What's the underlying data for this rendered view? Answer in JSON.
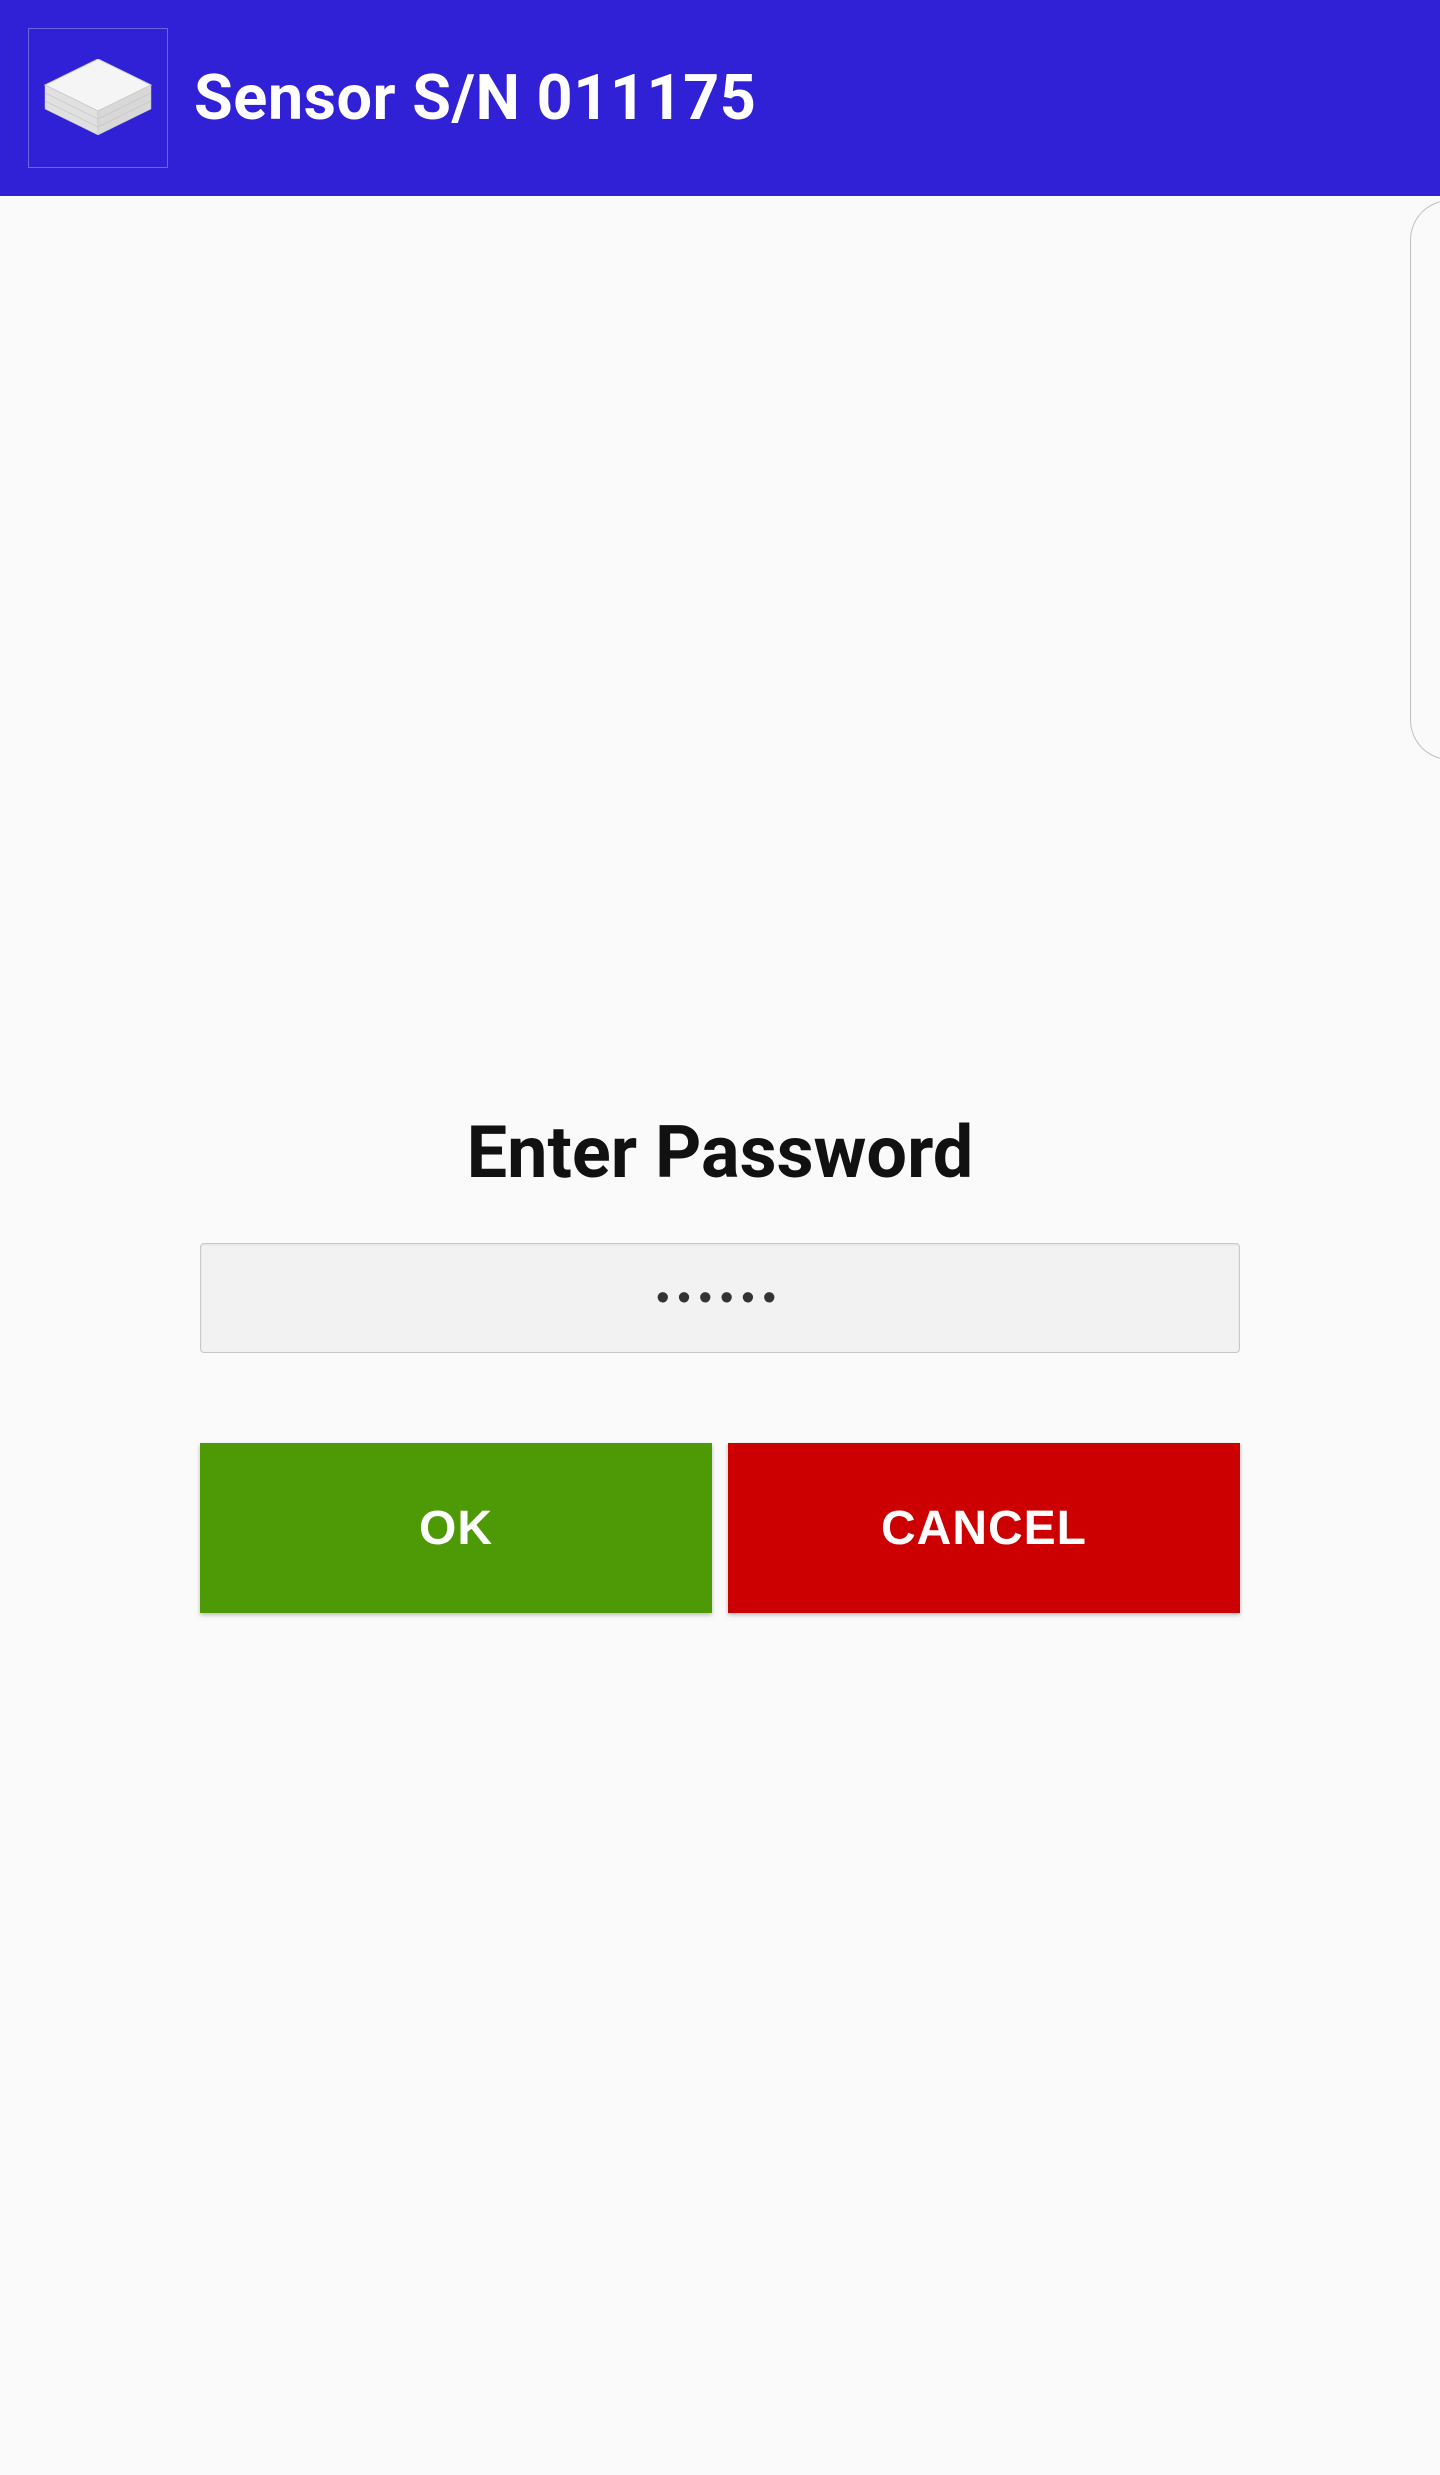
{
  "header": {
    "title": "Sensor S/N 011175"
  },
  "password_dialog": {
    "prompt": "Enter Password",
    "value": "••••••",
    "ok_label": "OK",
    "cancel_label": "CANCEL"
  },
  "colors": {
    "header_bg": "#3021d6",
    "ok_bg": "#4e9a06",
    "cancel_bg": "#cc0000"
  }
}
